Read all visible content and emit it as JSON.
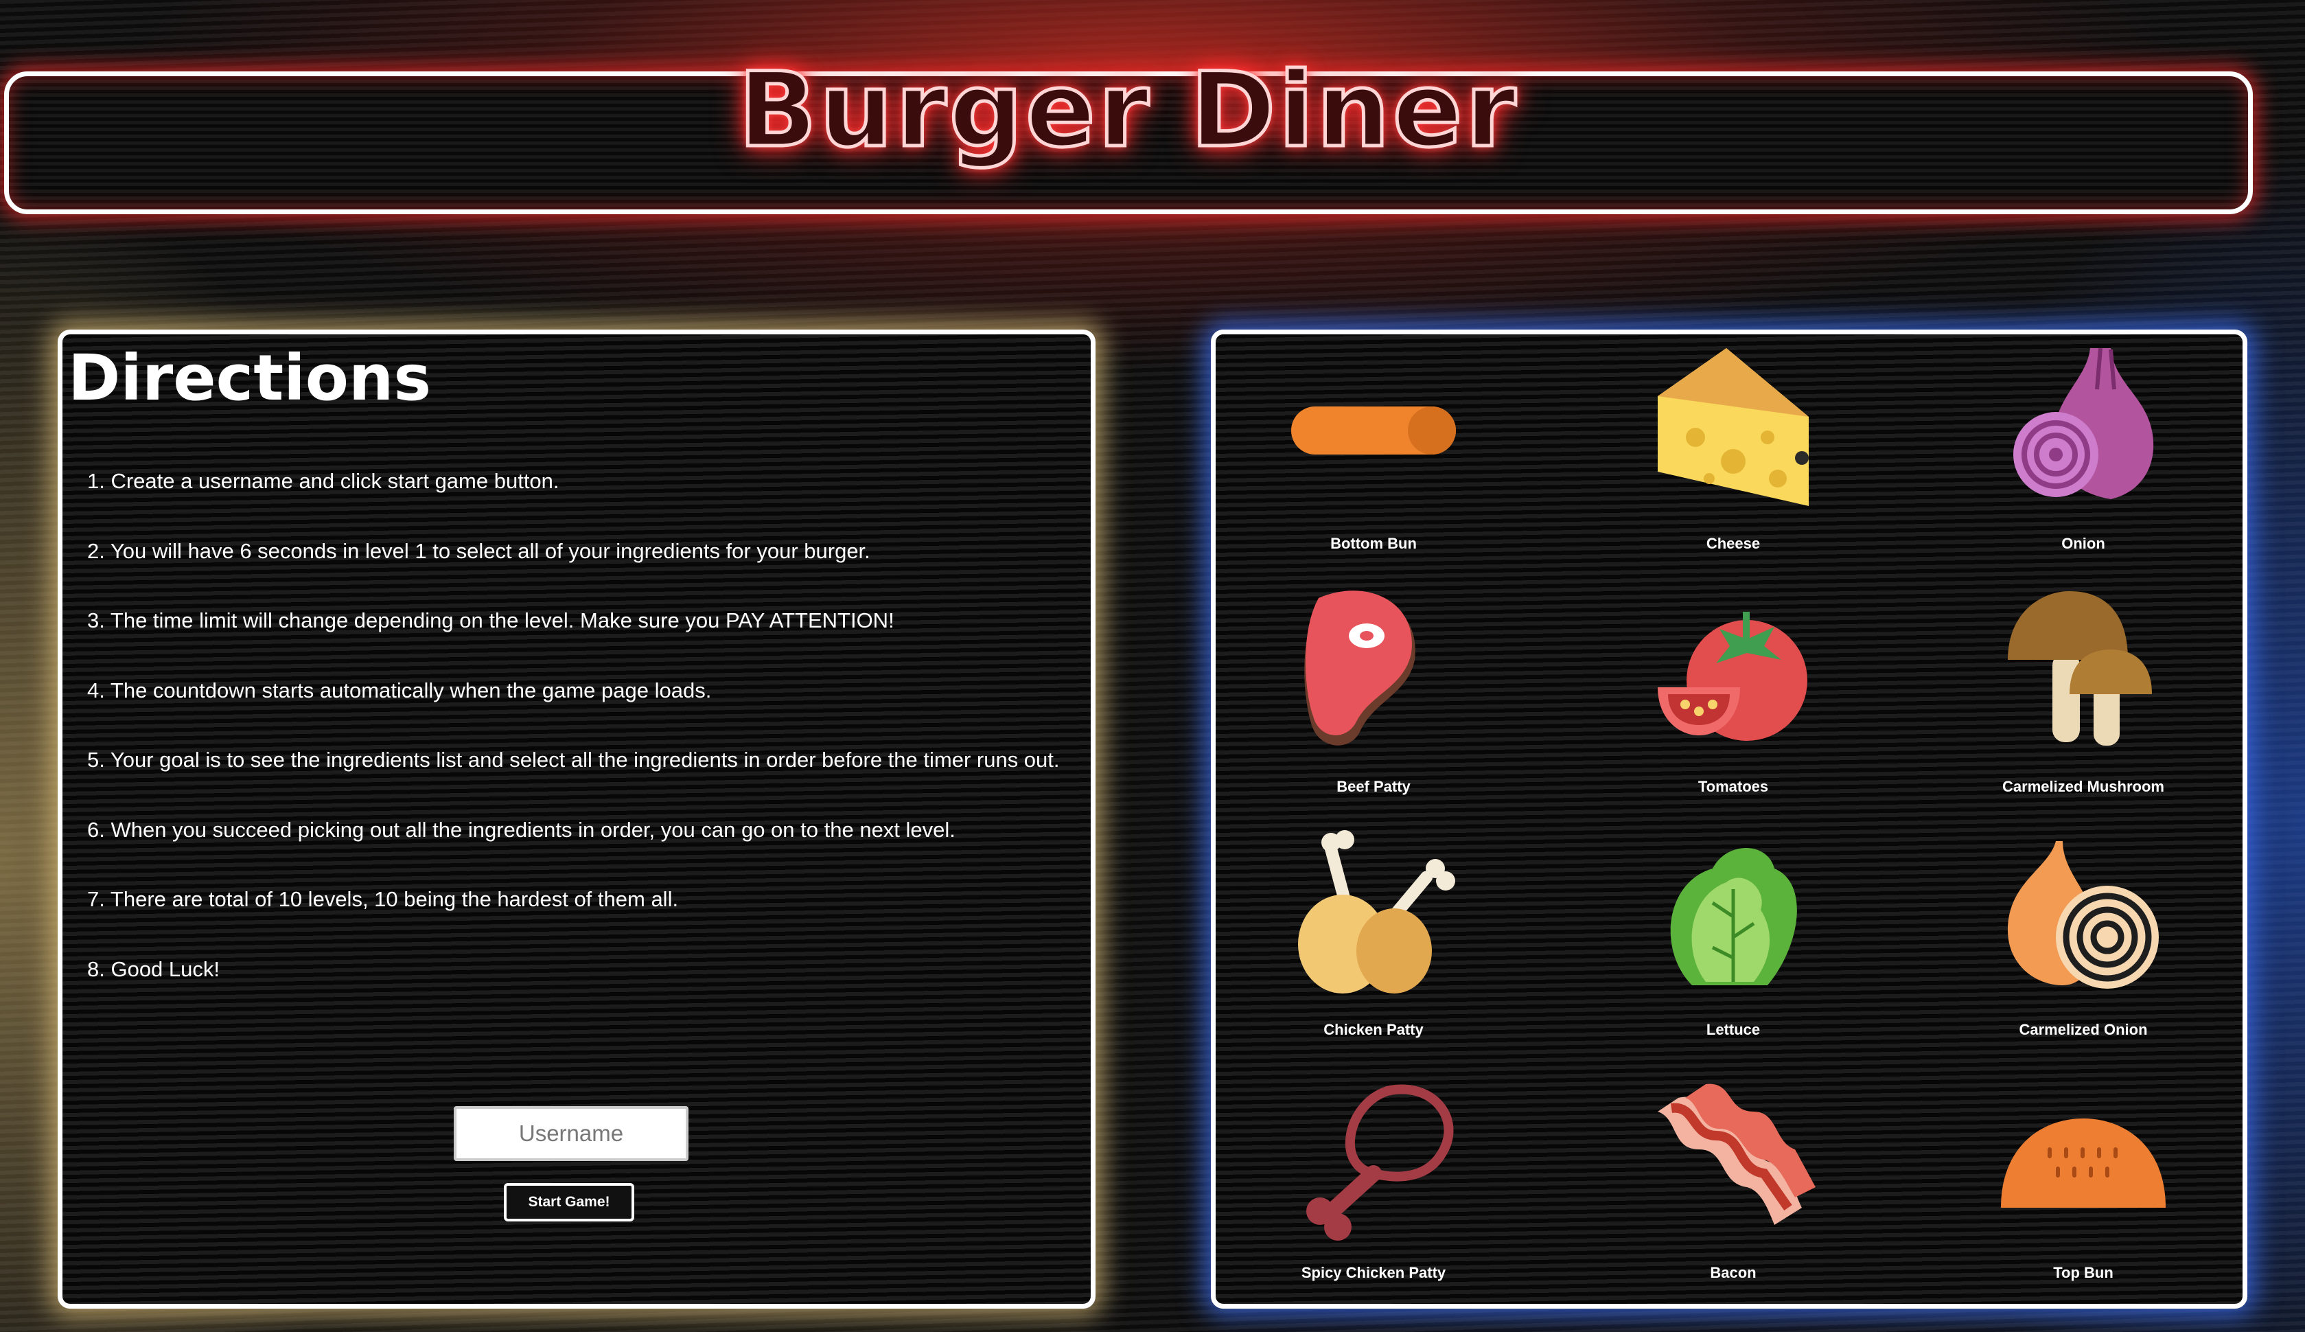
{
  "header": {
    "title": "Burger Diner"
  },
  "directions": {
    "heading": "Directions",
    "steps": [
      "1. Create a username and click start game button.",
      "2. You will have 6 seconds in level 1 to select all of your ingredients for your burger.",
      "3. The time limit will change depending on the level. Make sure you PAY ATTENTION!",
      "4. The countdown starts automatically when the game page loads.",
      "5. Your goal is to see the ingredients list and select all the ingredients in order before the timer runs out.",
      "6. When you succeed picking out all the ingredients in order, you can go on to the next level.",
      "7. There are total of 10 levels, 10 being the hardest of them all.",
      "8. Good Luck!"
    ],
    "username_placeholder": "Username",
    "start_button_label": "Start Game!"
  },
  "ingredients": [
    {
      "label": "Bottom Bun",
      "icon": "bottom-bun-icon"
    },
    {
      "label": "Cheese",
      "icon": "cheese-icon"
    },
    {
      "label": "Onion",
      "icon": "onion-icon"
    },
    {
      "label": "Beef Patty",
      "icon": "beef-patty-icon"
    },
    {
      "label": "Tomatoes",
      "icon": "tomato-icon"
    },
    {
      "label": "Carmelized Mushroom",
      "icon": "mushroom-icon"
    },
    {
      "label": "Chicken Patty",
      "icon": "chicken-leg-icon"
    },
    {
      "label": "Lettuce",
      "icon": "lettuce-icon"
    },
    {
      "label": "Carmelized Onion",
      "icon": "caramelized-onion-icon"
    },
    {
      "label": "Spicy Chicken Patty",
      "icon": "spicy-chicken-icon"
    },
    {
      "label": "Bacon",
      "icon": "bacon-icon"
    },
    {
      "label": "Top Bun",
      "icon": "top-bun-icon"
    }
  ],
  "colors": {
    "header_glow": "#e62828",
    "directions_glow": "#dcbe78",
    "ingredients_glow": "#3c6ef0"
  }
}
